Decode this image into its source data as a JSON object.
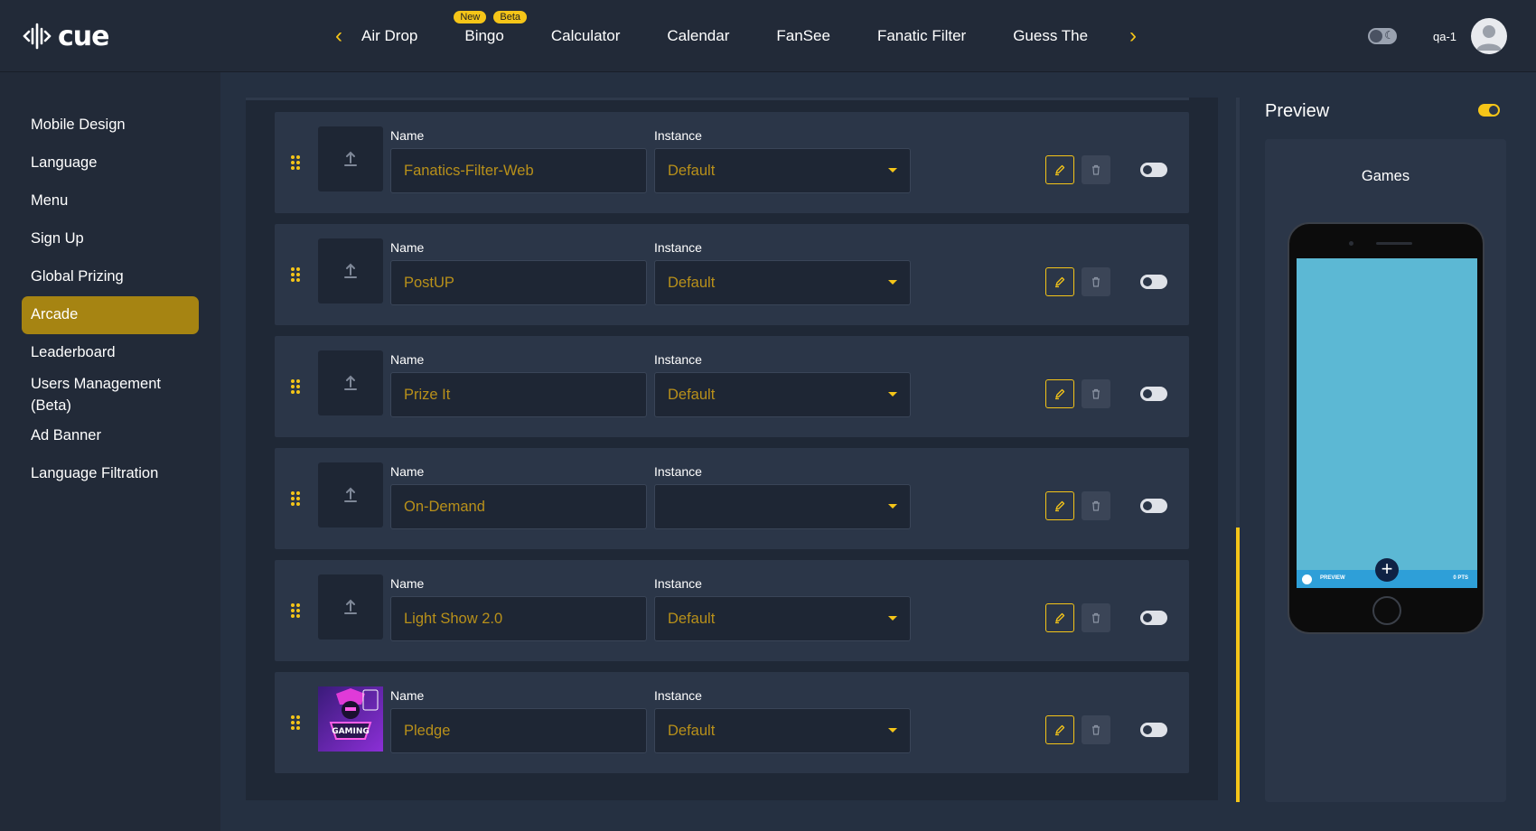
{
  "app": {
    "logo_text": "cue",
    "username": "qa-1"
  },
  "nav": {
    "tabs": [
      {
        "label": "Air Drop"
      },
      {
        "label": "Bingo",
        "badges": [
          "New",
          "Beta"
        ]
      },
      {
        "label": "Calculator"
      },
      {
        "label": "Calendar"
      },
      {
        "label": "FanSee"
      },
      {
        "label": "Fanatic Filter"
      },
      {
        "label": "Guess The"
      }
    ]
  },
  "sidebar": {
    "items": [
      {
        "label": "Mobile Design"
      },
      {
        "label": "Language"
      },
      {
        "label": "Menu"
      },
      {
        "label": "Sign Up"
      },
      {
        "label": "Global Prizing"
      },
      {
        "label": "Arcade",
        "active": true
      },
      {
        "label": "Leaderboard"
      },
      {
        "label": "Users Management (Beta)"
      },
      {
        "label": "Ad Banner"
      },
      {
        "label": "Language Filtration"
      }
    ]
  },
  "games": {
    "name_label": "Name",
    "instance_label": "Instance",
    "rows": [
      {
        "name": "Fanatics-Filter-Web",
        "instance": "Default",
        "has_image": false,
        "enabled": false
      },
      {
        "name": "PostUP",
        "instance": "Default",
        "has_image": false,
        "enabled": false
      },
      {
        "name": "Prize It",
        "instance": "Default",
        "has_image": false,
        "enabled": false
      },
      {
        "name": "On-Demand",
        "instance": "",
        "has_image": false,
        "enabled": false
      },
      {
        "name": "Light Show 2.0",
        "instance": "Default",
        "has_image": false,
        "enabled": false
      },
      {
        "name": "Pledge",
        "instance": "Default",
        "has_image": true,
        "image_text": "GAMING",
        "enabled": false
      }
    ]
  },
  "preview": {
    "title": "Preview",
    "enabled": true,
    "screen_title": "Games",
    "bar_left": "PREVIEW",
    "bar_right": "0 PTS"
  },
  "colors": {
    "accent": "#f5c518",
    "active_bg": "#a68412",
    "panel": "#2b3648",
    "screen": "#5cb8d4"
  }
}
